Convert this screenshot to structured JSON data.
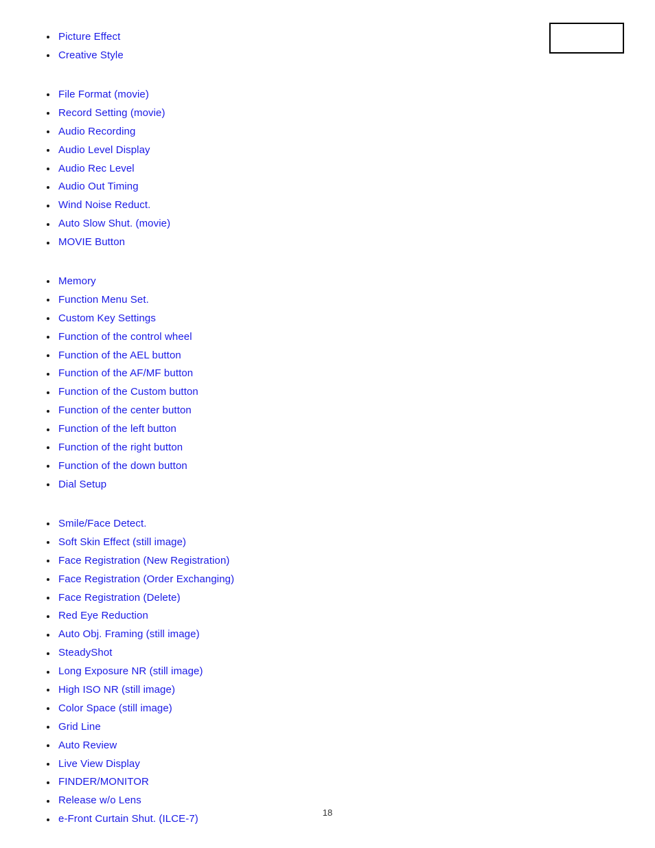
{
  "page": {
    "number": "18",
    "background_color": "#ffffff",
    "link_color": "#1a1ae6",
    "bullet_color": "#1a1a1a",
    "border_color": "#000000"
  },
  "corner_box": {
    "label": ""
  },
  "blocks": [
    {
      "id": "picture-settings",
      "items": [
        {
          "label": "Picture Effect"
        },
        {
          "label": "Creative Style"
        }
      ]
    },
    {
      "id": "movie-settings",
      "items": [
        {
          "label": "File Format (movie)"
        },
        {
          "label": "Record Setting (movie)"
        },
        {
          "label": "Audio Recording"
        },
        {
          "label": "Audio Level Display"
        },
        {
          "label": "Audio Rec Level"
        },
        {
          "label": "Audio Out Timing"
        },
        {
          "label": "Wind Noise Reduct."
        },
        {
          "label": "Auto Slow Shut. (movie)"
        },
        {
          "label": "MOVIE Button"
        }
      ]
    },
    {
      "id": "custom-settings",
      "items": [
        {
          "label": "Memory"
        },
        {
          "label": "Function Menu Set."
        },
        {
          "label": "Custom Key Settings"
        },
        {
          "label": "Function of the control wheel"
        },
        {
          "label": "Function of the AEL button"
        },
        {
          "label": "Function of the AF/MF button"
        },
        {
          "label": "Function of the Custom button"
        },
        {
          "label": "Function of the center button"
        },
        {
          "label": "Function of the left button"
        },
        {
          "label": "Function of the right button"
        },
        {
          "label": "Function of the down button"
        },
        {
          "label": "Dial Setup"
        }
      ]
    },
    {
      "id": "shooting-settings",
      "items": [
        {
          "label": "Smile/Face Detect."
        },
        {
          "label": "Soft Skin Effect (still image)"
        },
        {
          "label": "Face Registration (New Registration)"
        },
        {
          "label": "Face Registration (Order Exchanging)"
        },
        {
          "label": "Face Registration (Delete)"
        },
        {
          "label": "Red Eye Reduction"
        },
        {
          "label": "Auto Obj. Framing (still image)"
        },
        {
          "label": "SteadyShot"
        },
        {
          "label": "Long Exposure NR (still image)"
        },
        {
          "label": "High ISO NR (still image)"
        },
        {
          "label": "Color Space (still image)"
        },
        {
          "label": "Grid Line"
        },
        {
          "label": "Auto Review"
        },
        {
          "label": "Live View Display"
        },
        {
          "label": "FINDER/MONITOR"
        },
        {
          "label": "Release w/o Lens"
        },
        {
          "label": "e-Front Curtain Shut. (ILCE-7)"
        }
      ]
    }
  ]
}
